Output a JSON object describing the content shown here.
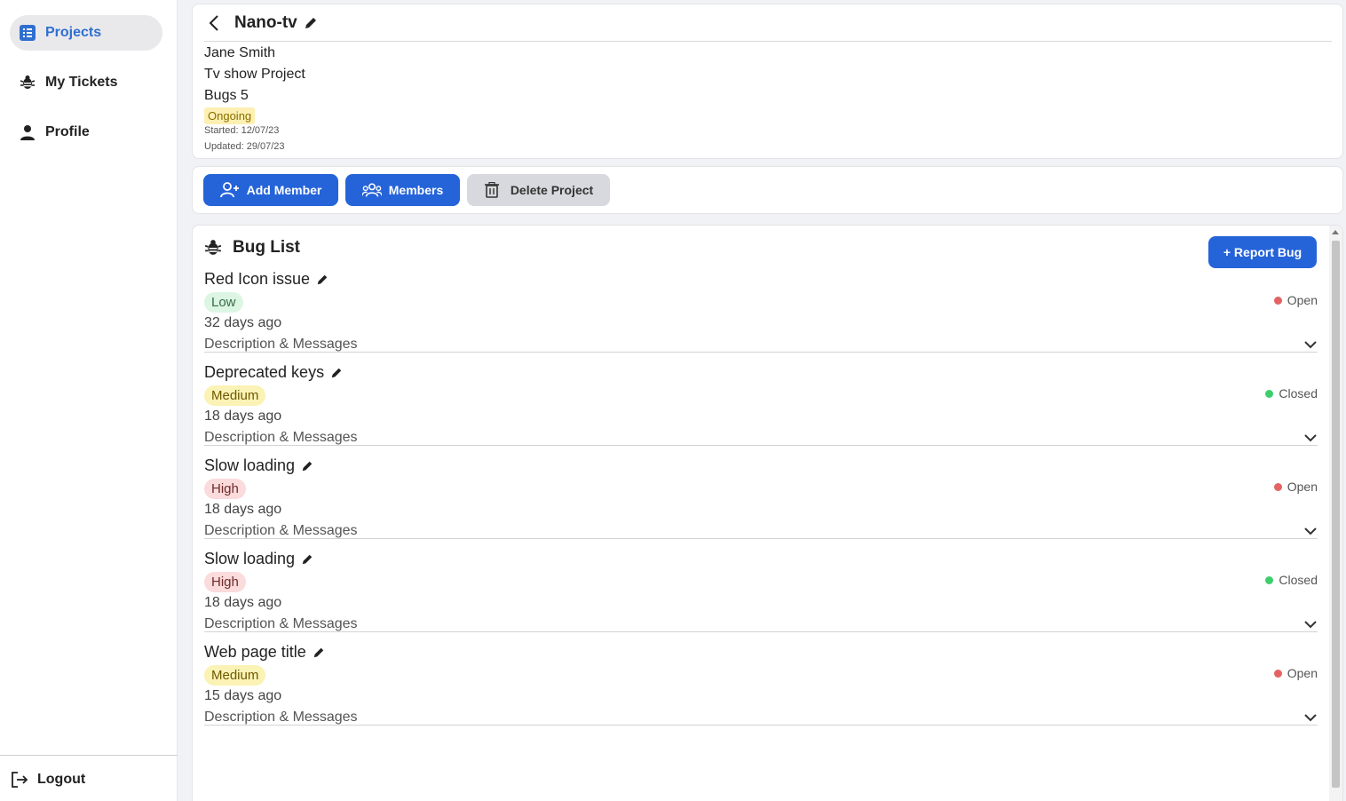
{
  "sidebar": {
    "items": [
      {
        "label": "Projects",
        "icon": "list-icon",
        "active": true
      },
      {
        "label": "My Tickets",
        "icon": "bug-icon",
        "active": false
      },
      {
        "label": "Profile",
        "icon": "person-icon",
        "active": false
      }
    ],
    "logout_label": "Logout"
  },
  "project": {
    "title": "Nano-tv",
    "owner": "Jane Smith",
    "description": "Tv show Project",
    "bugs_count": "Bugs 5",
    "status": "Ongoing",
    "started": "Started: 12/07/23",
    "updated": "Updated: 29/07/23"
  },
  "actions": {
    "add_member": "Add Member",
    "members": "Members",
    "delete_project": "Delete Project"
  },
  "bug_list": {
    "title": "Bug List",
    "report_button": "+ Report Bug",
    "desc_label": "Description & Messages",
    "bugs": [
      {
        "title": "Red Icon issue",
        "priority": "Low",
        "age": "32 days ago",
        "status": "Open"
      },
      {
        "title": "Deprecated keys",
        "priority": "Medium",
        "age": "18 days ago",
        "status": "Closed"
      },
      {
        "title": "Slow loading",
        "priority": "High",
        "age": "18 days ago",
        "status": "Open"
      },
      {
        "title": "Slow loading",
        "priority": "High",
        "age": "18 days ago",
        "status": "Closed"
      },
      {
        "title": "Web page title",
        "priority": "Medium",
        "age": "15 days ago",
        "status": "Open"
      }
    ]
  },
  "colors": {
    "accent": "#2563d9",
    "active_nav_text": "#2f6fd0",
    "status_open": "#e36363",
    "status_closed": "#3ccf6b"
  }
}
